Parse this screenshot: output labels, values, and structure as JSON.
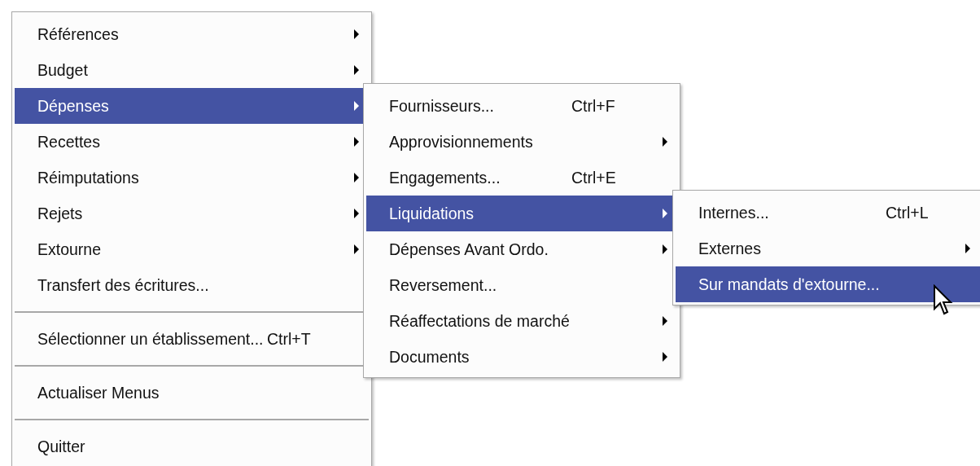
{
  "menus": [
    {
      "items": [
        {
          "kind": "item",
          "label": "Références",
          "submenu": true,
          "selected": false
        },
        {
          "kind": "item",
          "label": "Budget",
          "submenu": true,
          "selected": false
        },
        {
          "kind": "item",
          "label": "Dépenses",
          "submenu": true,
          "selected": true
        },
        {
          "kind": "item",
          "label": "Recettes",
          "submenu": true,
          "selected": false
        },
        {
          "kind": "item",
          "label": "Réimputations",
          "submenu": true,
          "selected": false
        },
        {
          "kind": "item",
          "label": "Rejets",
          "submenu": true,
          "selected": false
        },
        {
          "kind": "item",
          "label": "Extourne",
          "submenu": true,
          "selected": false
        },
        {
          "kind": "item",
          "label": "Transfert des écritures...",
          "submenu": false,
          "selected": false
        },
        {
          "kind": "separator"
        },
        {
          "kind": "item",
          "label": "Sélectionner un établissement...",
          "shortcut": "Ctrl+T",
          "submenu": false,
          "selected": false
        },
        {
          "kind": "separator"
        },
        {
          "kind": "item",
          "label": "Actualiser Menus",
          "submenu": false,
          "selected": false
        },
        {
          "kind": "separator"
        },
        {
          "kind": "item",
          "label": "Quitter",
          "submenu": false,
          "selected": false
        }
      ]
    },
    {
      "items": [
        {
          "kind": "item",
          "label": "Fournisseurs...",
          "shortcut": "Ctrl+F",
          "submenu": false,
          "selected": false
        },
        {
          "kind": "item",
          "label": "Approvisionnements",
          "submenu": true,
          "selected": false
        },
        {
          "kind": "item",
          "label": "Engagements...",
          "shortcut": "Ctrl+E",
          "submenu": false,
          "selected": false
        },
        {
          "kind": "item",
          "label": "Liquidations",
          "submenu": true,
          "selected": true
        },
        {
          "kind": "item",
          "label": "Dépenses Avant Ordo.",
          "submenu": true,
          "selected": false
        },
        {
          "kind": "item",
          "label": "Reversement...",
          "submenu": false,
          "selected": false
        },
        {
          "kind": "item",
          "label": "Réaffectations de marché",
          "submenu": true,
          "selected": false
        },
        {
          "kind": "item",
          "label": "Documents",
          "submenu": true,
          "selected": false
        }
      ]
    },
    {
      "items": [
        {
          "kind": "item",
          "label": "Internes...",
          "shortcut": "Ctrl+L",
          "submenu": false,
          "selected": false
        },
        {
          "kind": "item",
          "label": "Externes",
          "submenu": true,
          "selected": false
        },
        {
          "kind": "item",
          "label": "Sur mandats d'extourne...",
          "submenu": false,
          "selected": true
        }
      ]
    }
  ]
}
